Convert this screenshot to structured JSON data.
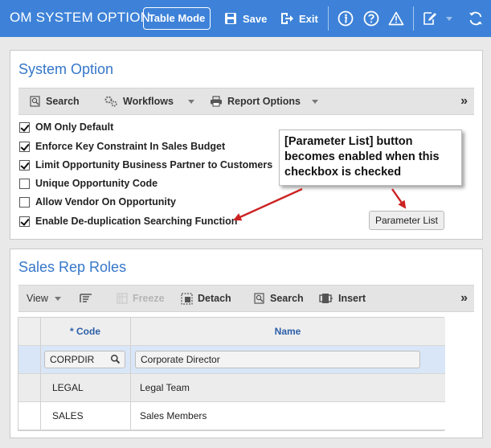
{
  "header": {
    "title": "OM SYSTEM OPTION",
    "table_mode": "Table Mode",
    "save": "Save",
    "exit": "Exit",
    "icons": [
      "save-icon",
      "exit-icon",
      "info-icon",
      "help-icon",
      "warning-icon",
      "note-icon",
      "refresh-icon"
    ]
  },
  "system_option": {
    "title": "System Option",
    "toolbar": {
      "search": "Search",
      "workflows": "Workflows",
      "report_options": "Report Options",
      "more": "»"
    },
    "checkboxes": [
      {
        "label": "OM Only Default",
        "checked": true
      },
      {
        "label": "Enforce Key Constraint In Sales Budget",
        "checked": true
      },
      {
        "label": "Limit Opportunity Business Partner to Customers",
        "checked": true
      },
      {
        "label": "Unique Opportunity Code",
        "checked": false
      },
      {
        "label": "Allow Vendor On Opportunity",
        "checked": false
      },
      {
        "label": "Enable De-duplication Searching Function",
        "checked": true
      }
    ],
    "parameter_list_button": "Parameter List",
    "callout": "[Parameter List] button becomes enabled when this checkbox is checked"
  },
  "sales_rep_roles": {
    "title": "Sales Rep Roles",
    "toolbar": {
      "view": "View",
      "freeze": "Freeze",
      "detach": "Detach",
      "search": "Search",
      "insert": "Insert",
      "more": "»"
    },
    "columns": {
      "code": "* Code",
      "name": "Name"
    },
    "rows": [
      {
        "code": "CORPDIR",
        "name": "Corporate Director"
      },
      {
        "code": "LEGAL",
        "name": "Legal Team"
      },
      {
        "code": "SALES",
        "name": "Sales Members"
      }
    ]
  },
  "colors": {
    "topbar": "#3d82d8",
    "title_blue": "#3577c9",
    "arrow_red": "#cc2222"
  }
}
